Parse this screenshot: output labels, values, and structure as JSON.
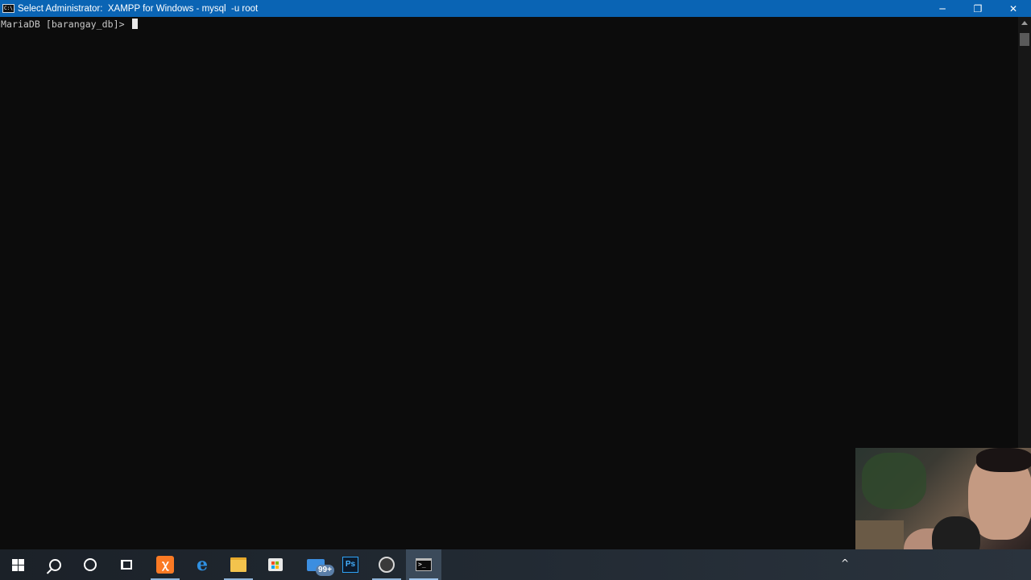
{
  "window": {
    "title": "Select Administrator:  XAMPP for Windows - mysql  -u root",
    "icon_label": "C:\\.",
    "controls": {
      "minimize": "─",
      "restore": "❐",
      "close": "✕"
    }
  },
  "console": {
    "prompt": "MariaDB [barangay_db]> "
  },
  "taskbar": {
    "items": [
      {
        "name": "start",
        "icon": "windows-logo-icon"
      },
      {
        "name": "search",
        "icon": "search-icon"
      },
      {
        "name": "cortana",
        "icon": "cortana-icon"
      },
      {
        "name": "task-view",
        "icon": "task-view-icon"
      },
      {
        "name": "xampp",
        "icon": "xampp-icon",
        "glyph": "ꭓ"
      },
      {
        "name": "edge",
        "icon": "edge-icon",
        "glyph": "e"
      },
      {
        "name": "file-explorer",
        "icon": "folder-icon"
      },
      {
        "name": "store",
        "icon": "store-icon"
      },
      {
        "name": "mail",
        "icon": "mail-icon",
        "badge": "99+"
      },
      {
        "name": "photoshop",
        "icon": "photoshop-icon",
        "glyph": "Ps"
      },
      {
        "name": "obs",
        "icon": "obs-icon"
      },
      {
        "name": "command-prompt",
        "icon": "command-prompt-icon",
        "glyph": ">_"
      }
    ],
    "tray_chevron": "^"
  },
  "colors": {
    "titlebar": "#0a64b4",
    "console_bg": "#0c0c0c",
    "console_fg": "#c8c8c8",
    "taskbar": "#1b2128"
  }
}
